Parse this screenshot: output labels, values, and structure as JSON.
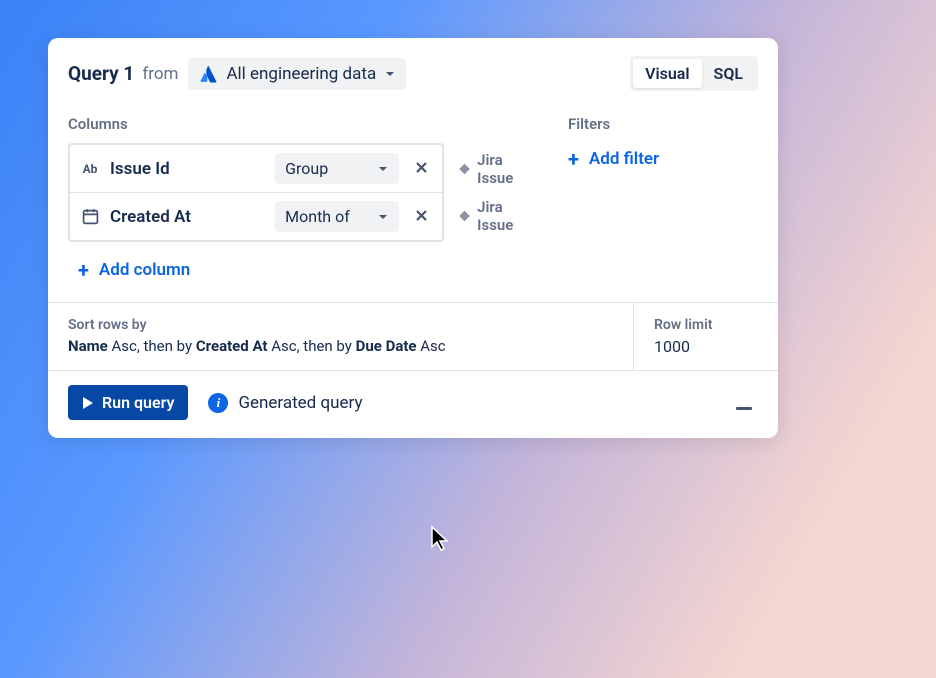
{
  "header": {
    "title": "Query 1",
    "from_label": "from",
    "source_name": "All engineering data"
  },
  "view_toggle": {
    "visual": "Visual",
    "sql": "SQL"
  },
  "sections": {
    "columns_label": "Columns",
    "filters_label": "Filters"
  },
  "columns": [
    {
      "type_icon": "Ab",
      "name": "Issue Id",
      "aggregation": "Group",
      "source": "Jira Issue"
    },
    {
      "type_icon": "calendar",
      "name": "Created At",
      "aggregation": "Month of",
      "source": "Jira Issue"
    }
  ],
  "actions": {
    "add_column": "Add column",
    "add_filter": "Add filter"
  },
  "sort": {
    "label": "Sort rows by",
    "parts": {
      "f1": "Name",
      "d1": "Asc",
      "sep1": ", then by ",
      "f2": "Created At",
      "d2": "Asc",
      "sep2": ", then by ",
      "f3": "Due Date",
      "d3": "Asc"
    }
  },
  "row_limit": {
    "label": "Row limit",
    "value": "1000"
  },
  "footer": {
    "run_label": "Run query",
    "generated_label": "Generated query"
  }
}
